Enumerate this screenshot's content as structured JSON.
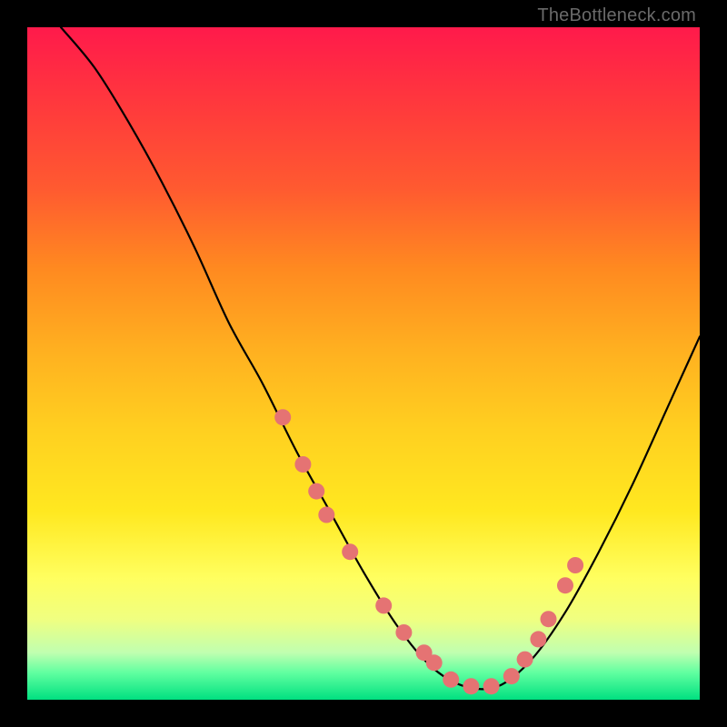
{
  "watermark": "TheBottleneck.com",
  "colors": {
    "gradient_top": "#ff1a4b",
    "gradient_mid": "#ffd020",
    "gradient_bottom": "#00e080",
    "line": "#000000",
    "dot": "#e57373",
    "background": "#000000"
  },
  "chart_data": {
    "type": "line",
    "title": "",
    "xlabel": "",
    "ylabel": "",
    "xlim": [
      0,
      100
    ],
    "ylim": [
      0,
      100
    ],
    "grid": false,
    "legend": null,
    "series": [
      {
        "name": "curve",
        "x": [
          5,
          10,
          15,
          20,
          25,
          30,
          35,
          40,
          45,
          50,
          55,
          60,
          65,
          70,
          75,
          80,
          85,
          90,
          95,
          100
        ],
        "y": [
          100,
          94,
          86,
          77,
          67,
          56,
          47,
          37,
          28,
          19,
          11,
          5,
          2,
          2,
          6,
          13,
          22,
          32,
          43,
          54
        ]
      }
    ],
    "markers": {
      "name": "dots",
      "x": [
        38,
        41,
        43,
        44.5,
        48,
        53,
        56,
        59,
        60.5,
        63,
        66,
        69,
        72,
        74,
        76,
        77.5,
        80,
        81.5
      ],
      "y": [
        42,
        35,
        31,
        27.5,
        22,
        14,
        10,
        7,
        5.5,
        3,
        2,
        2,
        3.5,
        6,
        9,
        12,
        17,
        20
      ]
    }
  }
}
